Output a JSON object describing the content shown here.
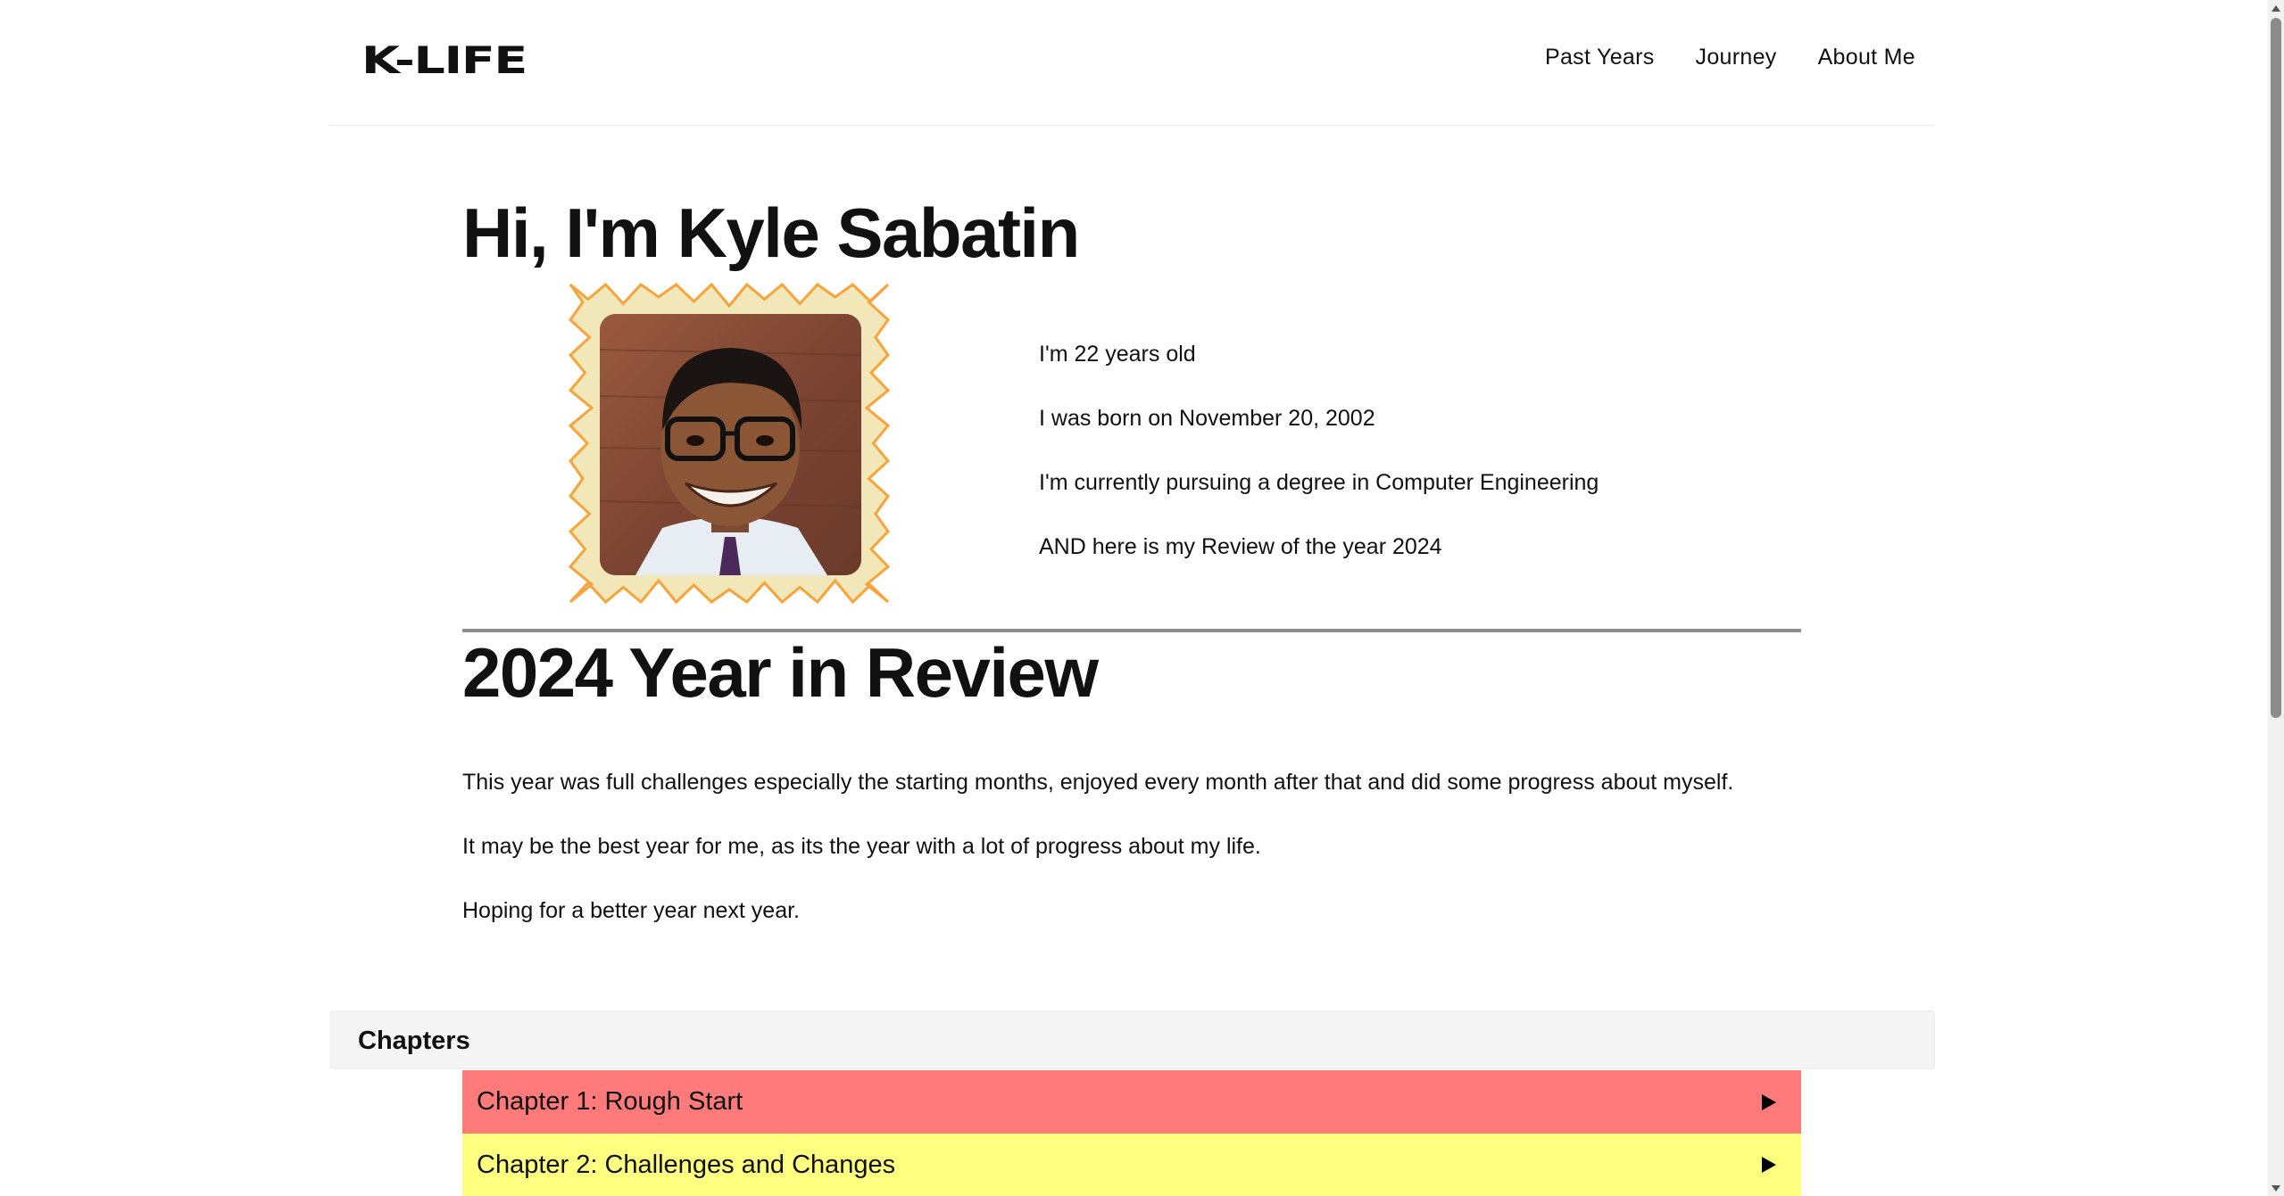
{
  "header": {
    "logo": "K-LIFE",
    "nav": [
      "Past Years",
      "Journey",
      "About Me"
    ]
  },
  "hero": {
    "title": "Hi, I'm Kyle Sabatin",
    "facts": [
      "I'm 22 years old",
      "I was born on November 20, 2002",
      "I'm currently pursuing a degree in Computer Engineering",
      "AND here is my Review of the year 2024"
    ]
  },
  "review": {
    "title": "2024 Year in Review",
    "paragraphs": [
      "This year was full challenges especially the starting months, enjoyed every month after that and did some progress about myself.",
      "It may be the best year for me, as its the year with a lot of progress about my life.",
      "Hoping for a better year next year."
    ]
  },
  "chapters": {
    "label": "Chapters",
    "items": [
      {
        "label": "Chapter 1: Rough Start",
        "color": "#ff7b7b"
      },
      {
        "label": "Chapter 2: Challenges and Changes",
        "color": "#ffff80"
      }
    ]
  },
  "colors": {
    "frame_fill": "#f1e7b9",
    "frame_stroke": "#f7a43c",
    "divider": "#8c8c8c"
  },
  "icons": {
    "chapter_toggle": "triangle-right-icon",
    "scroll_up": "arrow-up-icon",
    "scroll_down": "arrow-down-icon"
  }
}
